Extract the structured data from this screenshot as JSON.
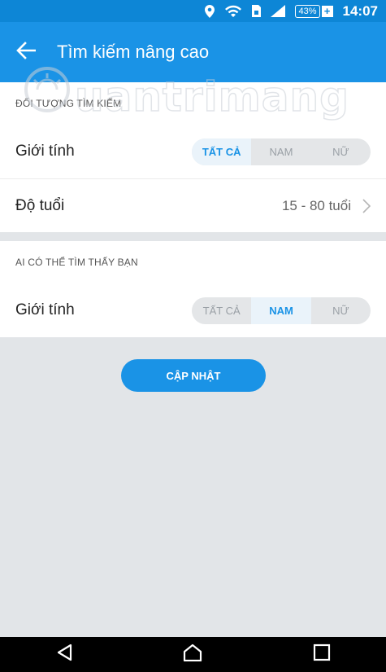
{
  "status_bar": {
    "battery": "43%",
    "time": "14:07"
  },
  "app_bar": {
    "title": "Tìm kiếm nâng cao"
  },
  "search_target": {
    "heading": "ĐỐI TƯỢNG TÌM KIẾM",
    "gender_label": "Giới tính",
    "gender_options": [
      "TẤT CẢ",
      "NAM",
      "NỮ"
    ],
    "gender_selected": "TẤT CẢ",
    "age_label": "Độ tuổi",
    "age_value": "15 - 80 tuổi"
  },
  "who_can_find": {
    "heading": "AI CÓ THỂ TÌM THẤY BẠN",
    "gender_label": "Giới tính",
    "gender_options": [
      "TẤT CẢ",
      "NAM",
      "NỮ"
    ],
    "gender_selected": "NAM"
  },
  "update_button": "CẬP NHẬT",
  "watermark": "uantrimang",
  "colors": {
    "primary": "#1a93e6",
    "status_bar": "#0d86d6",
    "background": "#e2e5e8"
  }
}
